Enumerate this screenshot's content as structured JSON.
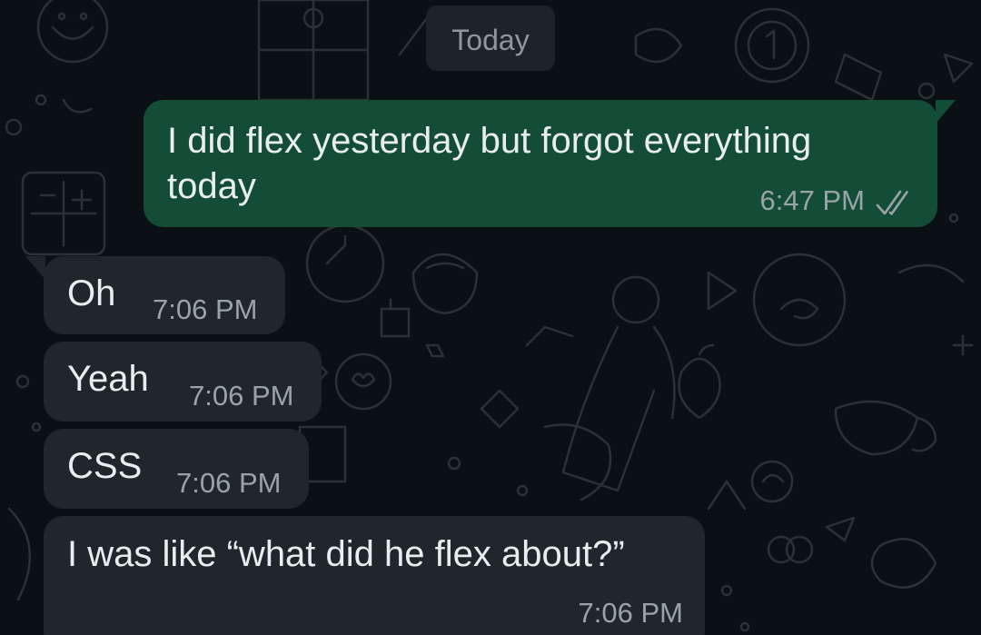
{
  "date_separator": "Today",
  "colors": {
    "background": "#0b1014",
    "outgoing_bubble": "#134d37",
    "incoming_bubble": "#1f272a",
    "text": "#e9edef",
    "timestamp": "#9aa3a8",
    "doodle_stroke": "#2a3236"
  },
  "messages": [
    {
      "direction": "outgoing",
      "text_line_1": "I did flex yesterday but forgot everything",
      "text_line_2": "today",
      "time": "6:47 PM",
      "status_icon": "double-check-icon"
    },
    {
      "direction": "incoming",
      "text": "Oh",
      "time": "7:06 PM"
    },
    {
      "direction": "incoming",
      "text": "Yeah",
      "time": "7:06 PM"
    },
    {
      "direction": "incoming",
      "text": "CSS",
      "time": "7:06 PM"
    },
    {
      "direction": "incoming",
      "text": "I was like “what did he flex about?”",
      "time": "7:06 PM"
    }
  ]
}
